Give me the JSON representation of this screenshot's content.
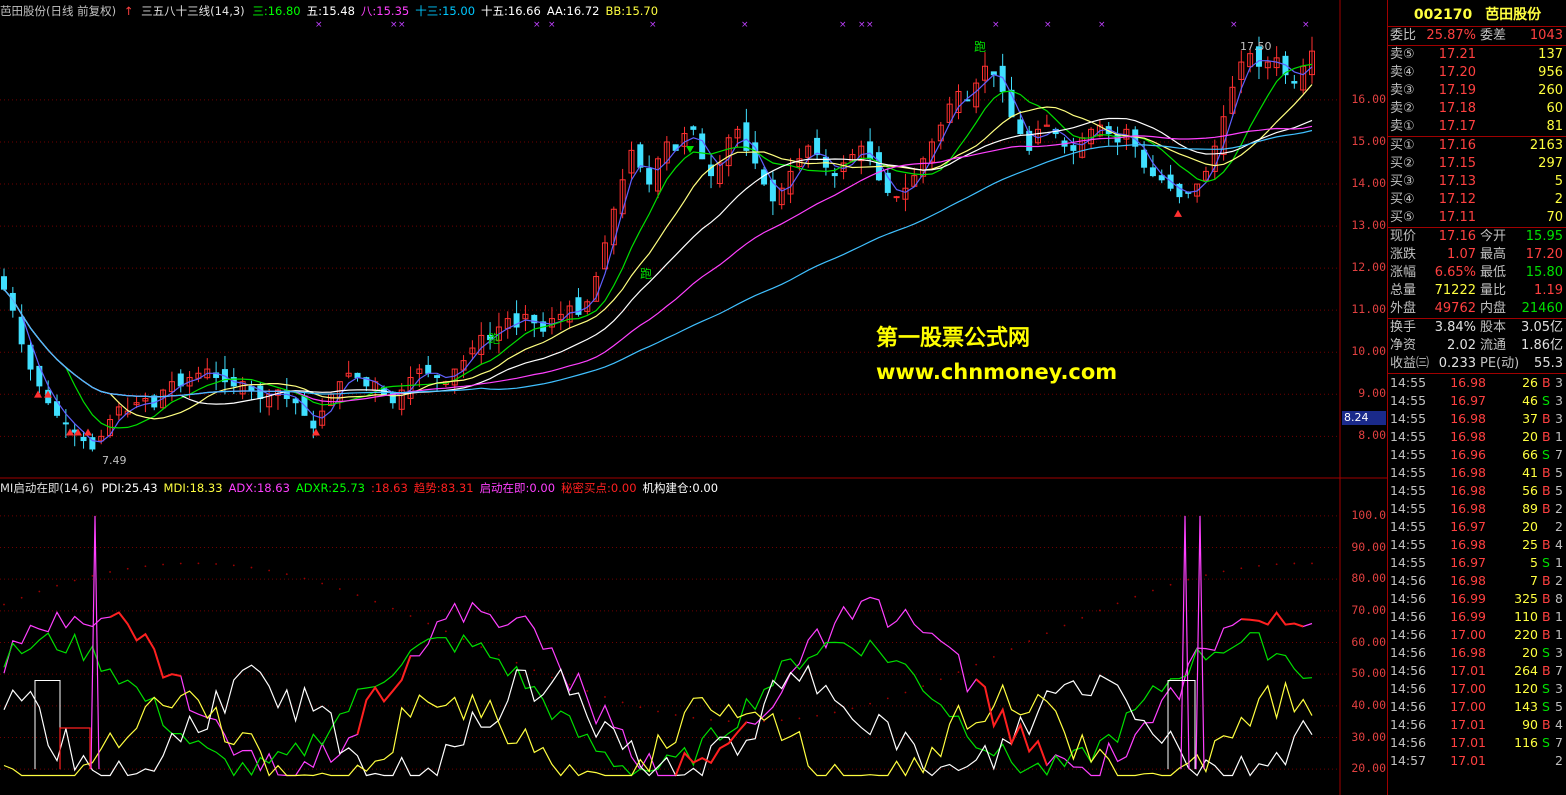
{
  "header": {
    "stock": "芭田股份(日线 前复权)",
    "ma_title": "三五八十三线(14,3)",
    "items": [
      {
        "text": "三:16.80",
        "color": "#00ff00"
      },
      {
        "text": "五:15.48",
        "color": "#ffffff"
      },
      {
        "text": "八:15.35",
        "color": "#ff40ff"
      },
      {
        "text": "十三:15.00",
        "color": "#00c8ff"
      },
      {
        "text": "十五:16.66",
        "color": "#ffffff"
      },
      {
        "text": "AA:16.72",
        "color": "#ffffff"
      },
      {
        "text": "BB:15.70",
        "color": "#ffff40"
      }
    ]
  },
  "sub_header": {
    "title": "MI启动在即(14,6)",
    "items": [
      {
        "text": "PDI:25.43",
        "color": "#ffffff"
      },
      {
        "text": "MDI:18.33",
        "color": "#ffff40"
      },
      {
        "text": "ADX:18.63",
        "color": "#ff40ff"
      },
      {
        "text": "ADXR:25.73",
        "color": "#00ff00"
      },
      {
        "text": ":18.63",
        "color": "#ff2020"
      },
      {
        "text": "趋势:83.31",
        "color": "#ff2020"
      },
      {
        "text": "启动在即:0.00",
        "color": "#ff40ff"
      },
      {
        "text": "秘密买点:0.00",
        "color": "#ff2020"
      },
      {
        "text": "机构建仓:0.00",
        "color": "#ffffff"
      }
    ]
  },
  "y_axis_main": [
    "16.00",
    "15.00",
    "14.00",
    "13.00",
    "12.00",
    "11.00",
    "10.00",
    "9.00",
    "8.00"
  ],
  "y_axis_sub": [
    "100.0",
    "90.00",
    "80.00",
    "70.00",
    "60.00",
    "50.00",
    "40.00",
    "30.00",
    "20.00"
  ],
  "price_tag": "8.24",
  "chart_labels": {
    "low": "7.49",
    "high": "17.50",
    "pao": "跑"
  },
  "watermark": {
    "line1": "第一股票公式网",
    "line2": "www.chnmoney.com"
  },
  "panel": {
    "code": "002170",
    "name": "芭田股份",
    "weibi": {
      "label": "委比",
      "value": "25.87%",
      "label2": "委差",
      "value2": "1043"
    },
    "sell": [
      {
        "label": "卖⑤",
        "price": "17.21",
        "vol": "137"
      },
      {
        "label": "卖④",
        "price": "17.20",
        "vol": "956"
      },
      {
        "label": "卖③",
        "price": "17.19",
        "vol": "260"
      },
      {
        "label": "卖②",
        "price": "17.18",
        "vol": "60"
      },
      {
        "label": "卖①",
        "price": "17.17",
        "vol": "81"
      }
    ],
    "buy": [
      {
        "label": "买①",
        "price": "17.16",
        "vol": "2163"
      },
      {
        "label": "买②",
        "price": "17.15",
        "vol": "297"
      },
      {
        "label": "买③",
        "price": "17.13",
        "vol": "5"
      },
      {
        "label": "买④",
        "price": "17.12",
        "vol": "2"
      },
      {
        "label": "买⑤",
        "price": "17.11",
        "vol": "70"
      }
    ],
    "stats1": [
      {
        "l1": "现价",
        "v1": "17.16",
        "c1": "red",
        "l2": "今开",
        "v2": "15.95",
        "c2": "green"
      },
      {
        "l1": "涨跌",
        "v1": "1.07",
        "c1": "red",
        "l2": "最高",
        "v2": "17.20",
        "c2": "red"
      },
      {
        "l1": "涨幅",
        "v1": "6.65%",
        "c1": "red",
        "l2": "最低",
        "v2": "15.80",
        "c2": "green"
      },
      {
        "l1": "总量",
        "v1": "71222",
        "c1": "yellow",
        "l2": "量比",
        "v2": "1.19",
        "c2": "red"
      },
      {
        "l1": "外盘",
        "v1": "49762",
        "c1": "red",
        "l2": "内盘",
        "v2": "21460",
        "c2": "green"
      }
    ],
    "stats2": [
      {
        "l1": "换手",
        "v1": "3.84%",
        "c1": "white",
        "l2": "股本",
        "v2": "3.05亿",
        "c2": "white"
      },
      {
        "l1": "净资",
        "v1": "2.02",
        "c1": "white",
        "l2": "流通",
        "v2": "1.86亿",
        "c2": "white"
      },
      {
        "l1": "收益㈢",
        "v1": "0.233",
        "c1": "white",
        "l2": "PE(动)",
        "v2": "55.3",
        "c2": "white"
      }
    ],
    "ticks": [
      {
        "time": "14:55",
        "price": "16.98",
        "vol": "26",
        "bs": "B",
        "n": "3"
      },
      {
        "time": "14:55",
        "price": "16.97",
        "vol": "46",
        "bs": "S",
        "n": "3"
      },
      {
        "time": "14:55",
        "price": "16.98",
        "vol": "37",
        "bs": "B",
        "n": "3"
      },
      {
        "time": "14:55",
        "price": "16.98",
        "vol": "20",
        "bs": "B",
        "n": "1"
      },
      {
        "time": "14:55",
        "price": "16.96",
        "vol": "66",
        "bs": "S",
        "n": "7"
      },
      {
        "time": "14:55",
        "price": "16.98",
        "vol": "41",
        "bs": "B",
        "n": "5"
      },
      {
        "time": "14:55",
        "price": "16.98",
        "vol": "56",
        "bs": "B",
        "n": "5"
      },
      {
        "time": "14:55",
        "price": "16.98",
        "vol": "89",
        "bs": "B",
        "n": "2"
      },
      {
        "time": "14:55",
        "price": "16.97",
        "vol": "20",
        "bs": "",
        "n": "2"
      },
      {
        "time": "14:55",
        "price": "16.98",
        "vol": "25",
        "bs": "B",
        "n": "4"
      },
      {
        "time": "14:55",
        "price": "16.97",
        "vol": "5",
        "bs": "S",
        "n": "1"
      },
      {
        "time": "14:56",
        "price": "16.98",
        "vol": "7",
        "bs": "B",
        "n": "2"
      },
      {
        "time": "14:56",
        "price": "16.99",
        "vol": "325",
        "bs": "B",
        "n": "8"
      },
      {
        "time": "14:56",
        "price": "16.99",
        "vol": "110",
        "bs": "B",
        "n": "1"
      },
      {
        "time": "14:56",
        "price": "17.00",
        "vol": "220",
        "bs": "B",
        "n": "1"
      },
      {
        "time": "14:56",
        "price": "16.98",
        "vol": "20",
        "bs": "S",
        "n": "3"
      },
      {
        "time": "14:56",
        "price": "17.01",
        "vol": "264",
        "bs": "B",
        "n": "7"
      },
      {
        "time": "14:56",
        "price": "17.00",
        "vol": "120",
        "bs": "S",
        "n": "3"
      },
      {
        "time": "14:56",
        "price": "17.00",
        "vol": "143",
        "bs": "S",
        "n": "5"
      },
      {
        "time": "14:56",
        "price": "17.01",
        "vol": "90",
        "bs": "B",
        "n": "4"
      },
      {
        "time": "14:56",
        "price": "17.01",
        "vol": "116",
        "bs": "S",
        "n": "7"
      },
      {
        "time": "14:57",
        "price": "17.01",
        "vol": "",
        "bs": "",
        "n": "2"
      }
    ]
  },
  "chart_data": {
    "type": "candlestick",
    "price_axis": {
      "min": 7.49,
      "max": 17.5
    },
    "indicator_axis": {
      "min": 20,
      "max": 100
    },
    "closes": [
      11.5,
      11.0,
      10.2,
      9.6,
      9.2,
      8.8,
      8.5,
      8.3,
      8.1,
      7.9,
      7.7,
      8.0,
      8.4,
      8.7,
      8.6,
      8.8,
      8.9,
      8.7,
      9.1,
      9.3,
      9.2,
      9.4,
      9.5,
      9.6,
      9.4,
      9.3,
      9.2,
      9.3,
      9.1,
      8.9,
      9.0,
      9.1,
      8.9,
      8.8,
      8.5,
      8.2,
      8.6,
      9.0,
      9.3,
      9.5,
      9.4,
      9.2,
      9.3,
      9.0,
      8.8,
      9.1,
      9.4,
      9.6,
      9.5,
      9.4,
      9.3,
      9.6,
      9.8,
      10.1,
      10.4,
      10.3,
      10.6,
      10.8,
      10.6,
      10.9,
      10.7,
      10.5,
      10.8,
      10.9,
      11.1,
      10.9,
      11.2,
      11.8,
      12.6,
      13.4,
      14.1,
      14.8,
      14.4,
      14.0,
      14.6,
      15.0,
      14.8,
      15.2,
      15.3,
      14.6,
      14.2,
      14.5,
      15.1,
      15.3,
      14.8,
      14.5,
      14.0,
      13.6,
      13.9,
      14.3,
      14.6,
      14.9,
      14.7,
      14.4,
      14.2,
      14.5,
      14.7,
      14.9,
      14.6,
      14.1,
      13.8,
      13.7,
      13.9,
      14.2,
      14.6,
      15.0,
      15.4,
      15.9,
      16.2,
      16.0,
      16.4,
      16.8,
      16.6,
      16.2,
      15.6,
      15.2,
      14.8,
      15.3,
      15.4,
      15.2,
      14.9,
      14.8,
      15.1,
      15.3,
      15.4,
      15.2,
      15.0,
      15.3,
      14.9,
      14.4,
      14.2,
      14.1,
      13.9,
      13.7,
      13.8,
      14.0,
      14.3,
      14.9,
      15.6,
      16.3,
      16.9,
      17.1,
      16.8,
      16.9,
      17.0,
      16.6,
      16.4,
      16.8,
      17.16
    ]
  }
}
